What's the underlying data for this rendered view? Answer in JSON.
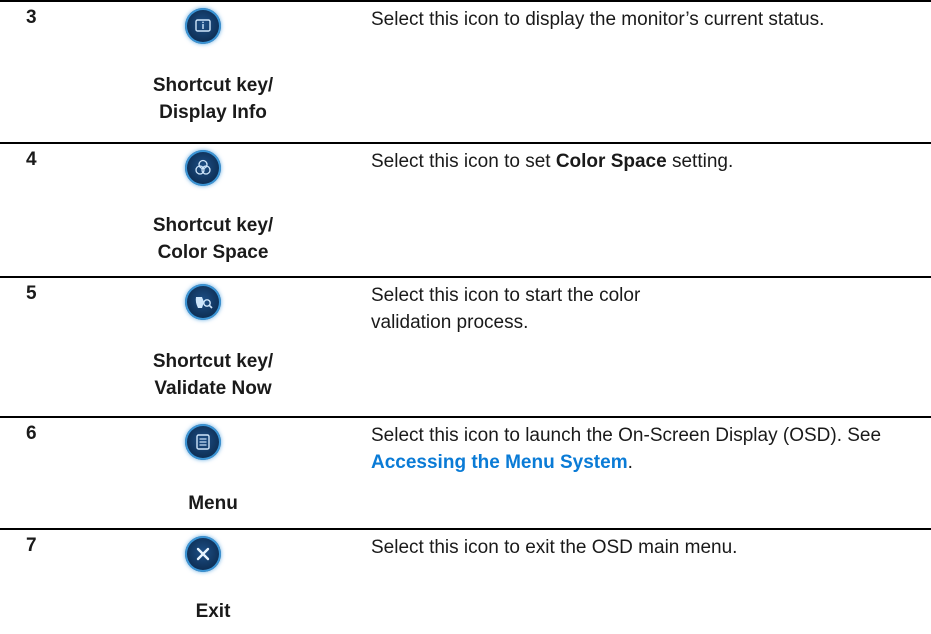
{
  "rows": [
    {
      "number": "3",
      "icon": "display-info-icon",
      "caption_line1": "Shortcut key/",
      "caption_line2": "Display Info",
      "description": "Select this icon to display the monitor’s current status."
    },
    {
      "number": "4",
      "icon": "color-space-icon",
      "caption_line1": "Shortcut key/",
      "caption_line2": "Color Space",
      "description_pre": "Select this icon to set ",
      "description_bold": "Color Space",
      "description_post": " setting."
    },
    {
      "number": "5",
      "icon": "validate-now-icon",
      "caption_line1": "Shortcut key/",
      "caption_line2": "Validate Now",
      "description": "Select this icon to start the color validation process."
    },
    {
      "number": "6",
      "icon": "menu-icon",
      "caption_line1": "Menu",
      "description_pre": "Select this icon to launch the On-Screen Display (OSD). See ",
      "description_link": "Accessing the Menu System",
      "description_post": "."
    },
    {
      "number": "7",
      "icon": "exit-icon",
      "caption_line1": "Exit",
      "description": "Select this icon to exit the OSD main menu."
    }
  ],
  "colors": {
    "rule": "#000000",
    "icon_bg": "#0d2d52",
    "icon_glow": "#3b95d6",
    "link": "#0a7bd6"
  }
}
